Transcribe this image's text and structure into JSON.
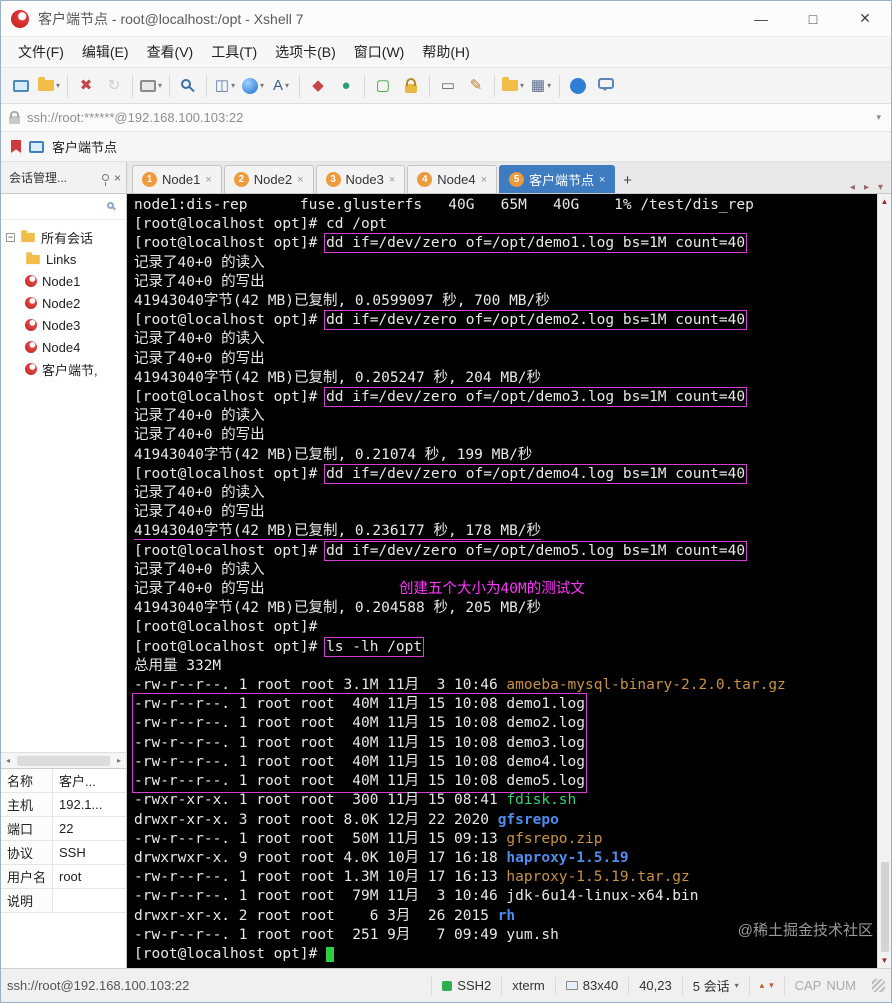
{
  "window": {
    "title": "客户端节点 - root@localhost:/opt - Xshell 7",
    "controls": {
      "minimize": "—",
      "maximize": "□",
      "close": "✕"
    }
  },
  "icons": {
    "dropdown": "▾",
    "close": "×",
    "minus": "−",
    "scroll_up": "▲",
    "scroll_down": "▼",
    "up_small": "▴",
    "down_small": "▾",
    "tab_prev": "◂",
    "tab_next": "▸",
    "hleft": "◂",
    "hright": "▸"
  },
  "colors": {
    "accent_blue": "#3d7cc1",
    "magenta_box": "#d63fd6",
    "annotation_magenta": "#ff35ff",
    "file_orange": "#c99240",
    "file_green": "#2fd272",
    "dir_blue": "#4e8cf0",
    "cursor_green": "#2ecc40",
    "tab_number_orange": "#ee9a3d"
  },
  "menu": {
    "items": [
      {
        "id": "file",
        "label": "文件(F)"
      },
      {
        "id": "edit",
        "label": "编辑(E)"
      },
      {
        "id": "view",
        "label": "查看(V)"
      },
      {
        "id": "tools",
        "label": "工具(T)"
      },
      {
        "id": "tab",
        "label": "选项卡(B)"
      },
      {
        "id": "window",
        "label": "窗口(W)"
      },
      {
        "id": "help",
        "label": "帮助(H)"
      }
    ]
  },
  "toolbar": {
    "items": [
      {
        "name": "new-session-icon",
        "kind": "monitor"
      },
      {
        "name": "open-session-icon",
        "kind": "folder",
        "dd": true
      },
      {
        "kind": "sep"
      },
      {
        "name": "disconnect-icon",
        "kind": "glyph",
        "glyph": "✖",
        "color": "#c64545"
      },
      {
        "name": "reconnect-icon",
        "kind": "glyph",
        "glyph": "↻",
        "color": "#a8a8a8",
        "disabled": true
      },
      {
        "kind": "sep"
      },
      {
        "name": "session-properties-icon",
        "kind": "monitor2",
        "dd": true
      },
      {
        "kind": "sep"
      },
      {
        "name": "find-icon",
        "kind": "find"
      },
      {
        "kind": "sep"
      },
      {
        "name": "split-view-icon",
        "kind": "glyph",
        "glyph": "◫",
        "color": "#5b7fae",
        "dd": true
      },
      {
        "name": "globe-icon",
        "kind": "globe",
        "dd": true
      },
      {
        "name": "font-icon",
        "kind": "glyph",
        "glyph": "A",
        "color": "#3f5f8f",
        "dd": true
      },
      {
        "kind": "sep"
      },
      {
        "name": "new-file-icon",
        "kind": "glyph",
        "glyph": "◆",
        "color": "#c64545"
      },
      {
        "name": "transfer-icon",
        "kind": "glyph",
        "glyph": "●",
        "color": "#2b9d6e"
      },
      {
        "kind": "sep"
      },
      {
        "name": "fullscreen-icon",
        "kind": "glyph",
        "glyph": "▢",
        "color": "#3aa43a"
      },
      {
        "name": "lock-icon",
        "kind": "lock"
      },
      {
        "kind": "sep"
      },
      {
        "name": "keyboard-icon",
        "kind": "glyph",
        "glyph": "▭",
        "color": "#666666"
      },
      {
        "name": "compose-icon",
        "kind": "glyph",
        "glyph": "✎",
        "color": "#c07a2e"
      },
      {
        "kind": "sep"
      },
      {
        "name": "transfer-folder-icon",
        "kind": "folder",
        "dd": true
      },
      {
        "name": "window-layout-icon",
        "kind": "glyph",
        "glyph": "▦",
        "color": "#5b6b8e",
        "dd": true
      },
      {
        "kind": "sep"
      },
      {
        "name": "help-icon",
        "kind": "help"
      },
      {
        "name": "message-icon",
        "kind": "bubble"
      }
    ]
  },
  "address": {
    "value": "ssh://root:******@192.168.100.103:22"
  },
  "bookmarks": {
    "items": [
      {
        "label": "客户端节点"
      }
    ]
  },
  "session_panel": {
    "header": "会话管理...",
    "root": "所有会话",
    "items": [
      {
        "id": "links",
        "label": "Links",
        "icon": "folder"
      },
      {
        "id": "node1",
        "label": "Node1",
        "icon": "session"
      },
      {
        "id": "node2",
        "label": "Node2",
        "icon": "session"
      },
      {
        "id": "node3",
        "label": "Node3",
        "icon": "session"
      },
      {
        "id": "node4",
        "label": "Node4",
        "icon": "session"
      },
      {
        "id": "client",
        "label": "客户端节,",
        "icon": "session"
      }
    ],
    "properties": [
      {
        "key": "名称",
        "value": "客户..."
      },
      {
        "key": "主机",
        "value": "192.1..."
      },
      {
        "key": "端口",
        "value": "22"
      },
      {
        "key": "协议",
        "value": "SSH"
      },
      {
        "key": "用户名",
        "value": "root"
      },
      {
        "key": "说明",
        "value": ""
      }
    ]
  },
  "tabs": {
    "items": [
      {
        "id": "node1",
        "num": "1",
        "label": "Node1",
        "active": false
      },
      {
        "id": "node2",
        "num": "2",
        "label": "Node2",
        "active": false
      },
      {
        "id": "node3",
        "num": "3",
        "label": "Node3",
        "active": false
      },
      {
        "id": "node4",
        "num": "4",
        "label": "Node4",
        "active": false
      },
      {
        "id": "client",
        "num": "5",
        "label": "客户端节点",
        "active": true
      }
    ],
    "add_label": "+"
  },
  "terminal": {
    "lines": [
      {
        "s": [
          {
            "t": "node1:dis-rep      fuse.glusterfs   40G   65M   40G    1% /test/dis_rep"
          }
        ]
      },
      {
        "s": [
          {
            "t": "[root@localhost opt]# cd /opt"
          }
        ]
      },
      {
        "s": [
          {
            "t": "[root@localhost opt]# "
          },
          {
            "t": "dd if=/dev/zero of=/opt/demo1.log bs=1M count=40",
            "box": true
          }
        ]
      },
      {
        "s": [
          {
            "t": "记录了40+0 的读入"
          }
        ]
      },
      {
        "s": [
          {
            "t": "记录了40+0 的写出"
          }
        ]
      },
      {
        "s": [
          {
            "t": "41943040字节(42 MB)已复制, 0.0599097 秒, 700 MB/秒"
          }
        ]
      },
      {
        "s": [
          {
            "t": "[root@localhost opt]# "
          },
          {
            "t": "dd if=/dev/zero of=/opt/demo2.log bs=1M count=40",
            "box": true
          }
        ]
      },
      {
        "s": [
          {
            "t": "记录了40+0 的读入"
          }
        ]
      },
      {
        "s": [
          {
            "t": "记录了40+0 的写出"
          }
        ]
      },
      {
        "s": [
          {
            "t": "41943040字节(42 MB)已复制, 0.205247 秒, 204 MB/秒"
          }
        ]
      },
      {
        "s": [
          {
            "t": "[root@localhost opt]# "
          },
          {
            "t": "dd if=/dev/zero of=/opt/demo3.log bs=1M count=40",
            "box": true
          }
        ]
      },
      {
        "s": [
          {
            "t": "记录了40+0 的读入"
          }
        ]
      },
      {
        "s": [
          {
            "t": "记录了40+0 的写出"
          }
        ]
      },
      {
        "s": [
          {
            "t": "41943040字节(42 MB)已复制, 0.21074 秒, 199 MB/秒"
          }
        ]
      },
      {
        "s": [
          {
            "t": "[root@localhost opt]# "
          },
          {
            "t": "dd if=/dev/zero of=/opt/demo4.log bs=1M count=40",
            "box": true
          }
        ]
      },
      {
        "s": [
          {
            "t": "记录了40+0 的读入"
          }
        ]
      },
      {
        "s": [
          {
            "t": "记录了40+0 的写出"
          }
        ]
      },
      {
        "s": [
          {
            "t": "41943040字节(42 MB)已复制, 0.236177 秒, 178 MB/秒",
            "u": true
          }
        ]
      },
      {
        "s": [
          {
            "t": "[root@localhost opt]# "
          },
          {
            "t": "dd if=/dev/zero of=/opt/demo5.log bs=1M count=40",
            "box": true
          }
        ]
      },
      {
        "s": [
          {
            "t": "记录了40+0 的读入"
          }
        ]
      },
      {
        "s": [
          {
            "t": "记录了40+0 的写出"
          },
          {
            "t": "创建五个大小为40M的测试文",
            "c": "ann"
          }
        ]
      },
      {
        "s": [
          {
            "t": "41943040字节(42 MB)已复制, 0.204588 秒, 205 MB/秒"
          }
        ]
      },
      {
        "s": [
          {
            "t": "[root@localhost opt]#"
          }
        ]
      },
      {
        "s": [
          {
            "t": "[root@localhost opt]# "
          },
          {
            "t": "ls -lh /opt",
            "box": true
          }
        ]
      },
      {
        "s": [
          {
            "t": "总用量 332M"
          }
        ]
      },
      {
        "s": [
          {
            "t": "-rw-r--r--. 1 root root 3.1M 11月  3 10:46 "
          },
          {
            "t": "amoeba-mysql-binary-2.2.0.tar.gz",
            "c": "orange"
          }
        ]
      },
      {
        "g": "demo",
        "s": [
          {
            "t": "-rw-r--r--. 1 root root  40M 11月 15 10:08 demo1.log"
          }
        ]
      },
      {
        "g": "demo",
        "s": [
          {
            "t": "-rw-r--r--. 1 root root  40M 11月 15 10:08 demo2.log"
          }
        ]
      },
      {
        "g": "demo",
        "s": [
          {
            "t": "-rw-r--r--. 1 root root  40M 11月 15 10:08 demo3.log"
          }
        ]
      },
      {
        "g": "demo",
        "s": [
          {
            "t": "-rw-r--r--. 1 root root  40M 11月 15 10:08 demo4.log"
          }
        ]
      },
      {
        "g": "demo",
        "s": [
          {
            "t": "-rw-r--r--. 1 root root  40M 11月 15 10:08 demo5.log"
          }
        ]
      },
      {
        "s": [
          {
            "t": "-rwxr-xr-x. 1 root root  300 11月 15 08:41 "
          },
          {
            "t": "fdisk.sh",
            "c": "green"
          }
        ]
      },
      {
        "s": [
          {
            "t": "drwxr-xr-x. 3 root root 8.0K 12月 22 2020 "
          },
          {
            "t": "gfsrepo",
            "c": "blue"
          }
        ]
      },
      {
        "s": [
          {
            "t": "-rw-r--r--. 1 root root  50M 11月 15 09:13 "
          },
          {
            "t": "gfsrepo.zip",
            "c": "orange"
          }
        ]
      },
      {
        "s": [
          {
            "t": "drwxrwxr-x. 9 root root 4.0K 10月 17 16:18 "
          },
          {
            "t": "haproxy-1.5.19",
            "c": "blue"
          }
        ]
      },
      {
        "s": [
          {
            "t": "-rw-r--r--. 1 root root 1.3M 10月 17 16:13 "
          },
          {
            "t": "haproxy-1.5.19.tar.gz",
            "c": "orange"
          }
        ]
      },
      {
        "s": [
          {
            "t": "-rw-r--r--. 1 root root  79M 11月  3 10:46 jdk-6u14-linux-x64.bin"
          }
        ]
      },
      {
        "s": [
          {
            "t": "drwxr-xr-x. 2 root root    6 3月  26 2015 "
          },
          {
            "t": "rh",
            "c": "blue"
          }
        ]
      },
      {
        "s": [
          {
            "t": "-rw-r--r--. 1 root root  251 9月   7 09:49 yum.sh"
          }
        ]
      },
      {
        "s": [
          {
            "t": "[root@localhost opt]# "
          }
        ],
        "cursor": true
      }
    ]
  },
  "watermark": "@稀土掘金技术社区",
  "status_bar": {
    "url": "ssh://root@192.168.100.103:22",
    "protocol": "SSH2",
    "terminal_type": "xterm",
    "size": "83x40",
    "cursor_position": "40,23",
    "sessions": "5 会话",
    "cap": "CAP",
    "num": "NUM"
  }
}
